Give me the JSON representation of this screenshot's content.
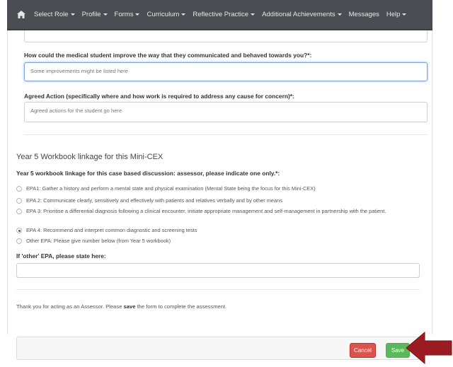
{
  "nav": {
    "home_icon": "home-icon",
    "items": [
      {
        "label": "Select Role",
        "has_caret": true
      },
      {
        "label": "Profile",
        "has_caret": true
      },
      {
        "label": "Forms",
        "has_caret": true
      },
      {
        "label": "Curriculum",
        "has_caret": true
      },
      {
        "label": "Reflective Practice",
        "has_caret": true
      },
      {
        "label": "Additional Achievements",
        "has_caret": true
      },
      {
        "label": "Messages",
        "has_caret": false
      },
      {
        "label": "Help",
        "has_caret": true
      }
    ]
  },
  "form": {
    "improve_question": "How could the medical student improve the way that they communicated and behaved towards you?*:",
    "improve_value": "Some improvements might be listed here",
    "agreed_label": "Agreed Action (specifically where and how work is required to address any cause for concern)*:",
    "agreed_value": "Agreed actions for the student go here",
    "section_heading": "Year 5 Workbook linkage for this Mini-CEX",
    "linkage_question": "Year 5 workbook linkage for this case based discussion: assessor, please indicate one only.*:",
    "options": [
      {
        "text": "EPA1: Gather a history and perform a mental state and physical examination (Mental State being the focus for this Mini-CEX)",
        "checked": false
      },
      {
        "text": "EPA 2: Communicate clearly, sensitively and effectively with patients and relatives verbally and by other means",
        "checked": false
      },
      {
        "text": "EPA 3: Prioritise a differential diagnosis following a clinical encounter, initiate appropriate management and self-management in partnership with the patient.",
        "checked": false
      },
      {
        "text": "EPA 4: Recommend and interpret common diagnostic and screening tests",
        "checked": true
      },
      {
        "text": "Other EPA: Please give number below (from Year 5 workbook)",
        "checked": false
      }
    ],
    "other_label": "If 'other' EPA, please state here:",
    "other_value": "",
    "thanks_prefix": "Thank you for acting as an Assessor. Please ",
    "thanks_bold": "save",
    "thanks_suffix": " the form to complete the assessment."
  },
  "footer": {
    "cancel_label": "Cancel",
    "save_label": "Save"
  },
  "colors": {
    "navbar": "#4a4e52",
    "cancel": "#d9534f",
    "save": "#5cb85c",
    "arrow": "#9b1b22"
  }
}
